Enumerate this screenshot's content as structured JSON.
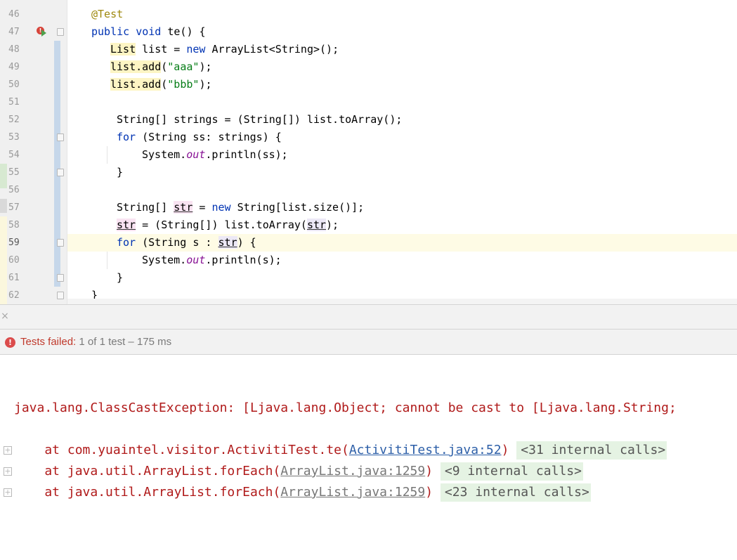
{
  "editor": {
    "first_line": 46,
    "line_numbers": [
      "46",
      "47",
      "48",
      "49",
      "50",
      "51",
      "52",
      "53",
      "54",
      "55",
      "56",
      "57",
      "58",
      "59",
      "60",
      "61",
      "62"
    ],
    "current_line": "59",
    "code": {
      "l46": "@Test",
      "l47_kw1": "public",
      "l47_kw2": "void",
      "l47_rest": " te() {",
      "l48_a": "List",
      "l48_b": " list = ",
      "l48_kw": "new",
      "l48_c": " ArrayList<String>();",
      "l49_a": "list.add",
      "l49_b": "(",
      "l49_str": "\"aaa\"",
      "l49_c": ");",
      "l50_a": "list.add",
      "l50_b": "(",
      "l50_str": "\"bbb\"",
      "l50_c": ");",
      "l52": "String[] strings = (String[]) list.toArray();",
      "l53_kw": "for",
      "l53_rest": " (String ss: strings) {",
      "l54_a": "System.",
      "l54_fld": "out",
      "l54_b": ".println(ss);",
      "l55": "}",
      "l57_a": "String[] ",
      "l57_var": "str",
      "l57_b": " = ",
      "l57_kw": "new",
      "l57_c": " String[list.size()];",
      "l58_var": "str",
      "l58_a": " = (String[]) list.toArray(",
      "l58_var2": "str",
      "l58_b": ");",
      "l59_kw": "for",
      "l59_a": " (String s : ",
      "l59_var": "str",
      "l59_b": ") {",
      "l60_a": "System.",
      "l60_fld": "out",
      "l60_b": ".println(s);",
      "l61": "}",
      "l62": "}"
    }
  },
  "test_panel": {
    "close_glyph": "×",
    "status_icon": "!",
    "status_failed_label": "Tests failed:",
    "status_detail": " 1 of 1 test – 175 ms",
    "exception": "java.lang.ClassCastException: [Ljava.lang.Object; cannot be cast to [Ljava.lang.String;",
    "expand_glyph": "+",
    "stack": [
      {
        "prefix": "    at com.yuaintel.visitor.ActivitiTest.te(",
        "link": "ActivitiTest.java:52",
        "suffix": ")",
        "internal": "<31 internal calls>",
        "link_style": "primary"
      },
      {
        "prefix": "    at java.util.ArrayList.forEach(",
        "link": "ArrayList.java:1259",
        "suffix": ")",
        "internal": "<9 internal calls>",
        "link_style": "gray"
      },
      {
        "prefix": "    at java.util.ArrayList.forEach(",
        "link": "ArrayList.java:1259",
        "suffix": ")",
        "internal": "<23 internal calls>",
        "link_style": "gray"
      }
    ]
  },
  "colors": {
    "keyword": "#0033b3",
    "string": "#067d17",
    "annotation": "#9e880d",
    "error": "#b01a1a",
    "link": "#2d5fa8"
  }
}
